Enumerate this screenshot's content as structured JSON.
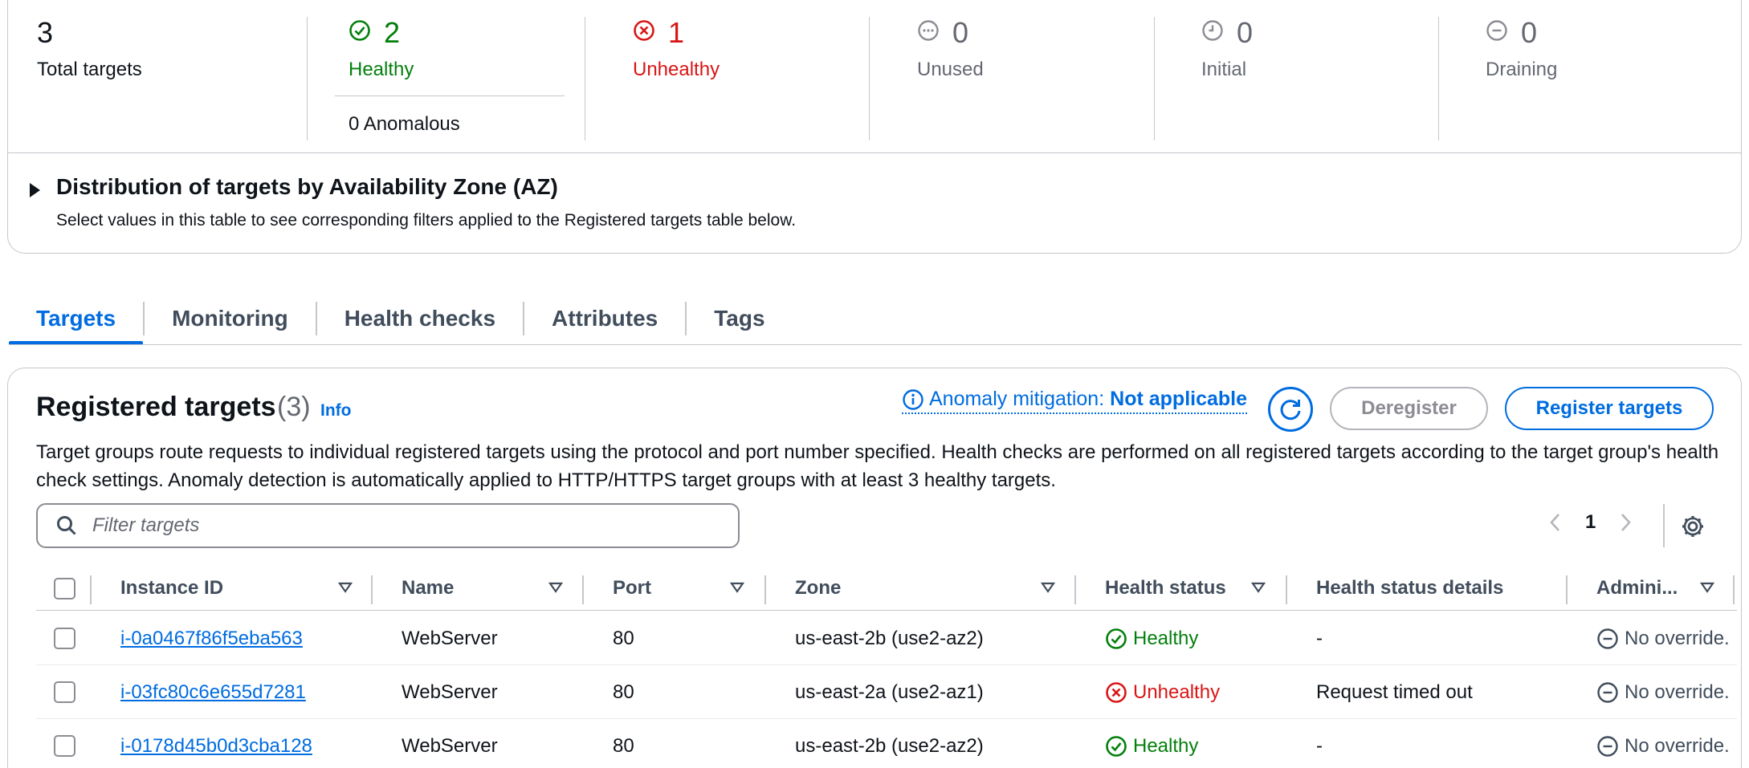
{
  "summary": {
    "total": {
      "count": "3",
      "label": "Total targets"
    },
    "healthy": {
      "count": "2",
      "label": "Healthy",
      "anomalous": "0 Anomalous"
    },
    "unhealthy": {
      "count": "1",
      "label": "Unhealthy"
    },
    "unused": {
      "count": "0",
      "label": "Unused"
    },
    "initial": {
      "count": "0",
      "label": "Initial"
    },
    "draining": {
      "count": "0",
      "label": "Draining"
    }
  },
  "az_distribution": {
    "title": "Distribution of targets by Availability Zone (AZ)",
    "description": "Select values in this table to see corresponding filters applied to the Registered targets table below."
  },
  "tabs": [
    {
      "label": "Targets",
      "active": true
    },
    {
      "label": "Monitoring"
    },
    {
      "label": "Health checks"
    },
    {
      "label": "Attributes"
    },
    {
      "label": "Tags"
    }
  ],
  "registered": {
    "title": "Registered targets",
    "count": "(3)",
    "info": "Info",
    "anomaly_label": "Anomaly mitigation:",
    "anomaly_value": "Not applicable",
    "deregister": "Deregister",
    "register": "Register targets",
    "description": "Target groups route requests to individual registered targets using the protocol and port number specified. Health checks are performed on all registered targets according to the target group's health check settings. Anomaly detection is automatically applied to HTTP/HTTPS target groups with at least 3 healthy targets.",
    "search_placeholder": "Filter targets",
    "page": "1"
  },
  "table": {
    "columns": [
      "Instance ID",
      "Name",
      "Port",
      "Zone",
      "Health status",
      "Health status details",
      "Admini..."
    ],
    "rows": [
      {
        "id": "i-0a0467f86f5eba563",
        "name": "WebServer",
        "port": "80",
        "zone": "us-east-2b (use2-az2)",
        "health": "Healthy",
        "details": "-",
        "admin": "No override."
      },
      {
        "id": "i-03fc80c6e655d7281",
        "name": "WebServer",
        "port": "80",
        "zone": "us-east-2a (use2-az1)",
        "health": "Unhealthy",
        "details": "Request timed out",
        "admin": "No override."
      },
      {
        "id": "i-0178d45b0d3cba128",
        "name": "WebServer",
        "port": "80",
        "zone": "us-east-2b (use2-az2)",
        "health": "Healthy",
        "details": "-",
        "admin": "No override."
      }
    ]
  },
  "colors": {
    "accent": "#006ce0",
    "healthy": "#037f0c",
    "unhealthy": "#d91515",
    "muted": "#656871"
  }
}
